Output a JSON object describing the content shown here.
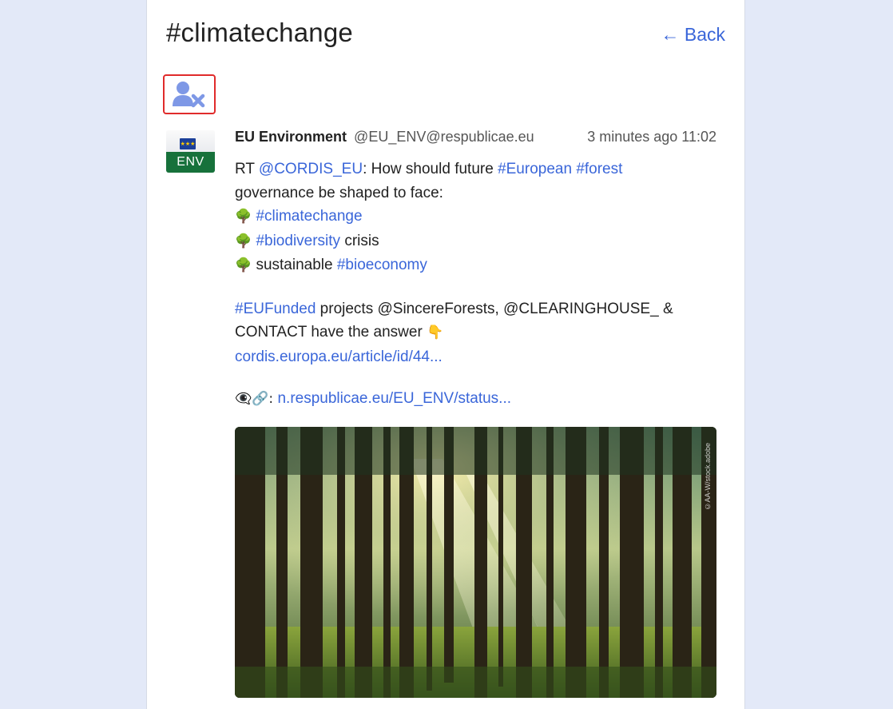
{
  "header": {
    "title": "#climatechange",
    "back_label": "← Back"
  },
  "toolbar": {
    "unfollow_icon": "user-x-icon",
    "accent": "#3a66d9",
    "highlight_border": "#e02b2b"
  },
  "post": {
    "avatar_label": "ENV",
    "author_name": "EU Environment",
    "author_handle": "@EU_ENV@respublicae.eu",
    "time": "3 minutes ago 11:02",
    "line1_prefix": "RT ",
    "mention_cordis": "@CORDIS_EU",
    "line1_text": ": How should future ",
    "tag_european": "#European",
    "tag_forest": "#forest",
    "line2": "governance be shaped to face:",
    "tree_emoji": "🌳",
    "tag_climate": "#climatechange",
    "tag_biodiversity": "#biodiversity",
    "crisis": " crisis",
    "sustainable": " sustainable ",
    "tag_bioeconomy": "#bioeconomy",
    "tag_eufunded": "#EUFunded",
    "projects_text": " projects @SincereForests, @CLEARINGHOUSE_ &",
    "contact_text": "CONTACT have the answer ",
    "point_emoji": "👇",
    "article_link": "cordis.europa.eu/article/id/44...",
    "source_prefix": "👁‍🗨🔗: ",
    "status_link": "n.respublicae.eu/EU_ENV/status...",
    "media_credit": "©AA-W/stock.adobe"
  }
}
